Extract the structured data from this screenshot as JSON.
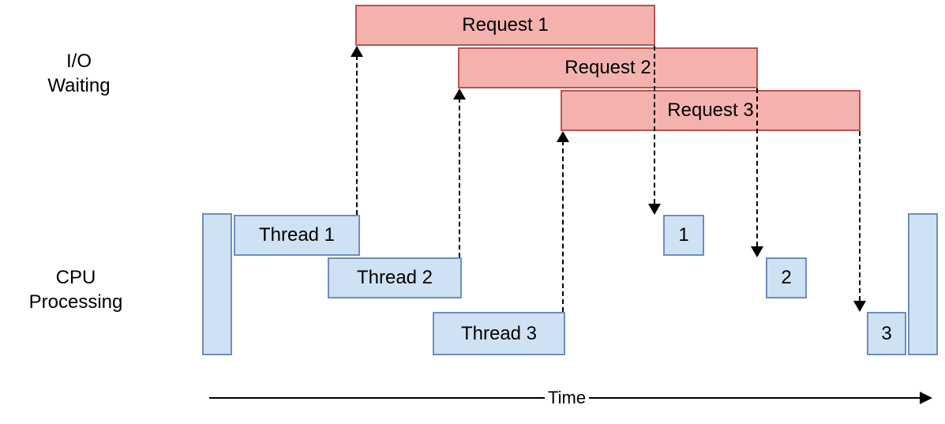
{
  "labels": {
    "io_waiting_line1": "I/O",
    "io_waiting_line2": "Waiting",
    "cpu_processing_line1": "CPU",
    "cpu_processing_line2": "Processing",
    "time": "Time"
  },
  "requests": [
    {
      "label": "Request 1"
    },
    {
      "label": "Request 2"
    },
    {
      "label": "Request 3"
    }
  ],
  "threads": [
    {
      "label": "Thread 1",
      "short": "1"
    },
    {
      "label": "Thread 2",
      "short": "2"
    },
    {
      "label": "Thread 3",
      "short": "3"
    }
  ]
}
